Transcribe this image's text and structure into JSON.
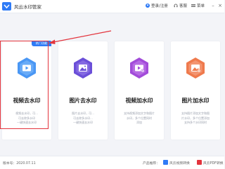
{
  "app": {
    "title": "风云水印管家",
    "account_label": "登录/注册",
    "service_label": "客服",
    "menu_label": "菜单"
  },
  "cards": [
    {
      "title": "视频去水印",
      "badge": "热门功能",
      "desc": [
        "视频去水印，可...",
        "可去除多水印",
        "一键快速去水印"
      ]
    },
    {
      "title": "图片去水印",
      "badge": "",
      "desc": [
        "图片去水印，可...",
        "可去除多水印...",
        "一键快速去水印"
      ]
    },
    {
      "title": "视频加水印",
      "badge": "",
      "desc": [
        "支持视频添加文字和图片",
        "水印，多个位置同时",
        "添加"
      ]
    },
    {
      "title": "图片加水印",
      "badge": "",
      "desc": [
        "支持图片添加文字和图",
        "片水印，多个位置添加",
        "支持多个水印同时"
      ]
    }
  ],
  "footer": {
    "version_text": "版本号：2020.07.11",
    "product_recommend": "产品推荐：",
    "product1": "风云视频转换",
    "product2": "风云PDF转换"
  },
  "colors": {
    "accent": "#2f7bf6",
    "highlight_red": "#e3343d",
    "card1": "#4a97f4",
    "card2": "#6b4fd8",
    "card3": "#a24bd9",
    "card4": "#ef7a4d"
  }
}
